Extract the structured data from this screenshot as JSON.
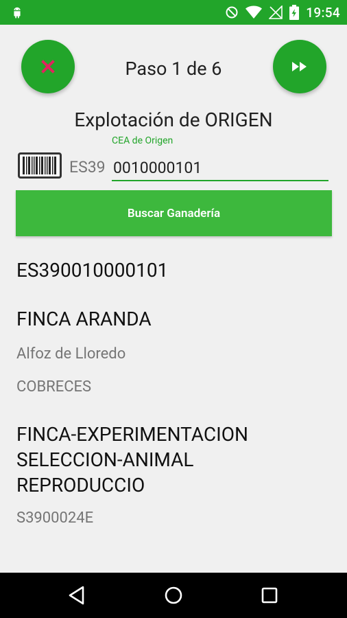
{
  "status_bar": {
    "time": "19:54",
    "icons": [
      "android-icon",
      "do-not-disturb-icon",
      "wifi-icon",
      "signal-icon",
      "battery-charging-icon"
    ]
  },
  "header": {
    "step_label": "Paso 1 de 6",
    "cancel_icon": "close-icon",
    "next_icon": "fast-forward-icon"
  },
  "form": {
    "title": "Explotación de ORIGEN",
    "field_hint": "CEA de Origen",
    "prefix": "ES39",
    "cea_value": "0010000101",
    "search_button_label": "Buscar Ganadería",
    "barcode_icon": "barcode-icon"
  },
  "result": {
    "code": "ES390010000101",
    "farm_name": "FINCA ARANDA",
    "municipality": "Alfoz de Lloredo",
    "locality": "COBRECES",
    "owner_name": "FINCA-EXPERIMENTACION SELECCION-ANIMAL REPRODUCCIO",
    "owner_id": "S3900024E"
  },
  "nav_bar": {
    "icons": [
      "back-icon",
      "home-icon",
      "recents-icon"
    ]
  },
  "colors": {
    "primary": "#22a52a",
    "button": "#3db83d",
    "cancel_x": "#e0245e",
    "secondary_text": "#757575"
  }
}
